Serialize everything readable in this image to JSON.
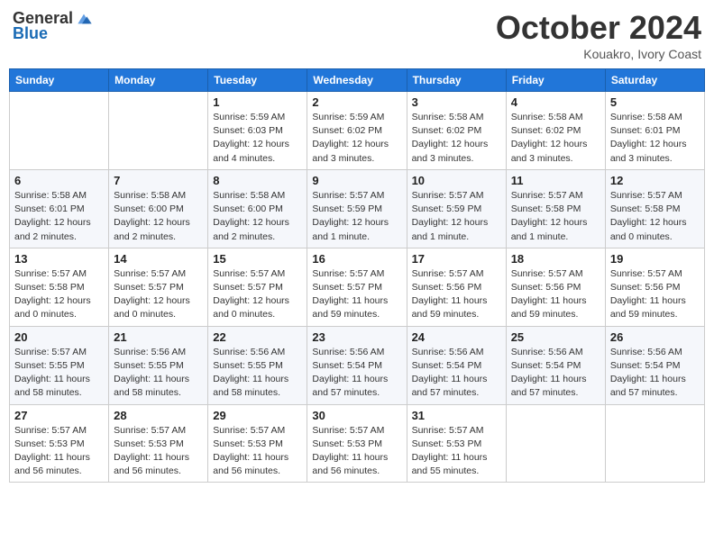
{
  "header": {
    "logo_general": "General",
    "logo_blue": "Blue",
    "month": "October 2024",
    "location": "Kouakro, Ivory Coast"
  },
  "days_of_week": [
    "Sunday",
    "Monday",
    "Tuesday",
    "Wednesday",
    "Thursday",
    "Friday",
    "Saturday"
  ],
  "weeks": [
    [
      {
        "day": "",
        "info": ""
      },
      {
        "day": "",
        "info": ""
      },
      {
        "day": "1",
        "info": "Sunrise: 5:59 AM\nSunset: 6:03 PM\nDaylight: 12 hours and 4 minutes."
      },
      {
        "day": "2",
        "info": "Sunrise: 5:59 AM\nSunset: 6:02 PM\nDaylight: 12 hours and 3 minutes."
      },
      {
        "day": "3",
        "info": "Sunrise: 5:58 AM\nSunset: 6:02 PM\nDaylight: 12 hours and 3 minutes."
      },
      {
        "day": "4",
        "info": "Sunrise: 5:58 AM\nSunset: 6:02 PM\nDaylight: 12 hours and 3 minutes."
      },
      {
        "day": "5",
        "info": "Sunrise: 5:58 AM\nSunset: 6:01 PM\nDaylight: 12 hours and 3 minutes."
      }
    ],
    [
      {
        "day": "6",
        "info": "Sunrise: 5:58 AM\nSunset: 6:01 PM\nDaylight: 12 hours and 2 minutes."
      },
      {
        "day": "7",
        "info": "Sunrise: 5:58 AM\nSunset: 6:00 PM\nDaylight: 12 hours and 2 minutes."
      },
      {
        "day": "8",
        "info": "Sunrise: 5:58 AM\nSunset: 6:00 PM\nDaylight: 12 hours and 2 minutes."
      },
      {
        "day": "9",
        "info": "Sunrise: 5:57 AM\nSunset: 5:59 PM\nDaylight: 12 hours and 1 minute."
      },
      {
        "day": "10",
        "info": "Sunrise: 5:57 AM\nSunset: 5:59 PM\nDaylight: 12 hours and 1 minute."
      },
      {
        "day": "11",
        "info": "Sunrise: 5:57 AM\nSunset: 5:58 PM\nDaylight: 12 hours and 1 minute."
      },
      {
        "day": "12",
        "info": "Sunrise: 5:57 AM\nSunset: 5:58 PM\nDaylight: 12 hours and 0 minutes."
      }
    ],
    [
      {
        "day": "13",
        "info": "Sunrise: 5:57 AM\nSunset: 5:58 PM\nDaylight: 12 hours and 0 minutes."
      },
      {
        "day": "14",
        "info": "Sunrise: 5:57 AM\nSunset: 5:57 PM\nDaylight: 12 hours and 0 minutes."
      },
      {
        "day": "15",
        "info": "Sunrise: 5:57 AM\nSunset: 5:57 PM\nDaylight: 12 hours and 0 minutes."
      },
      {
        "day": "16",
        "info": "Sunrise: 5:57 AM\nSunset: 5:57 PM\nDaylight: 11 hours and 59 minutes."
      },
      {
        "day": "17",
        "info": "Sunrise: 5:57 AM\nSunset: 5:56 PM\nDaylight: 11 hours and 59 minutes."
      },
      {
        "day": "18",
        "info": "Sunrise: 5:57 AM\nSunset: 5:56 PM\nDaylight: 11 hours and 59 minutes."
      },
      {
        "day": "19",
        "info": "Sunrise: 5:57 AM\nSunset: 5:56 PM\nDaylight: 11 hours and 59 minutes."
      }
    ],
    [
      {
        "day": "20",
        "info": "Sunrise: 5:57 AM\nSunset: 5:55 PM\nDaylight: 11 hours and 58 minutes."
      },
      {
        "day": "21",
        "info": "Sunrise: 5:56 AM\nSunset: 5:55 PM\nDaylight: 11 hours and 58 minutes."
      },
      {
        "day": "22",
        "info": "Sunrise: 5:56 AM\nSunset: 5:55 PM\nDaylight: 11 hours and 58 minutes."
      },
      {
        "day": "23",
        "info": "Sunrise: 5:56 AM\nSunset: 5:54 PM\nDaylight: 11 hours and 57 minutes."
      },
      {
        "day": "24",
        "info": "Sunrise: 5:56 AM\nSunset: 5:54 PM\nDaylight: 11 hours and 57 minutes."
      },
      {
        "day": "25",
        "info": "Sunrise: 5:56 AM\nSunset: 5:54 PM\nDaylight: 11 hours and 57 minutes."
      },
      {
        "day": "26",
        "info": "Sunrise: 5:56 AM\nSunset: 5:54 PM\nDaylight: 11 hours and 57 minutes."
      }
    ],
    [
      {
        "day": "27",
        "info": "Sunrise: 5:57 AM\nSunset: 5:53 PM\nDaylight: 11 hours and 56 minutes."
      },
      {
        "day": "28",
        "info": "Sunrise: 5:57 AM\nSunset: 5:53 PM\nDaylight: 11 hours and 56 minutes."
      },
      {
        "day": "29",
        "info": "Sunrise: 5:57 AM\nSunset: 5:53 PM\nDaylight: 11 hours and 56 minutes."
      },
      {
        "day": "30",
        "info": "Sunrise: 5:57 AM\nSunset: 5:53 PM\nDaylight: 11 hours and 56 minutes."
      },
      {
        "day": "31",
        "info": "Sunrise: 5:57 AM\nSunset: 5:53 PM\nDaylight: 11 hours and 55 minutes."
      },
      {
        "day": "",
        "info": ""
      },
      {
        "day": "",
        "info": ""
      }
    ]
  ]
}
